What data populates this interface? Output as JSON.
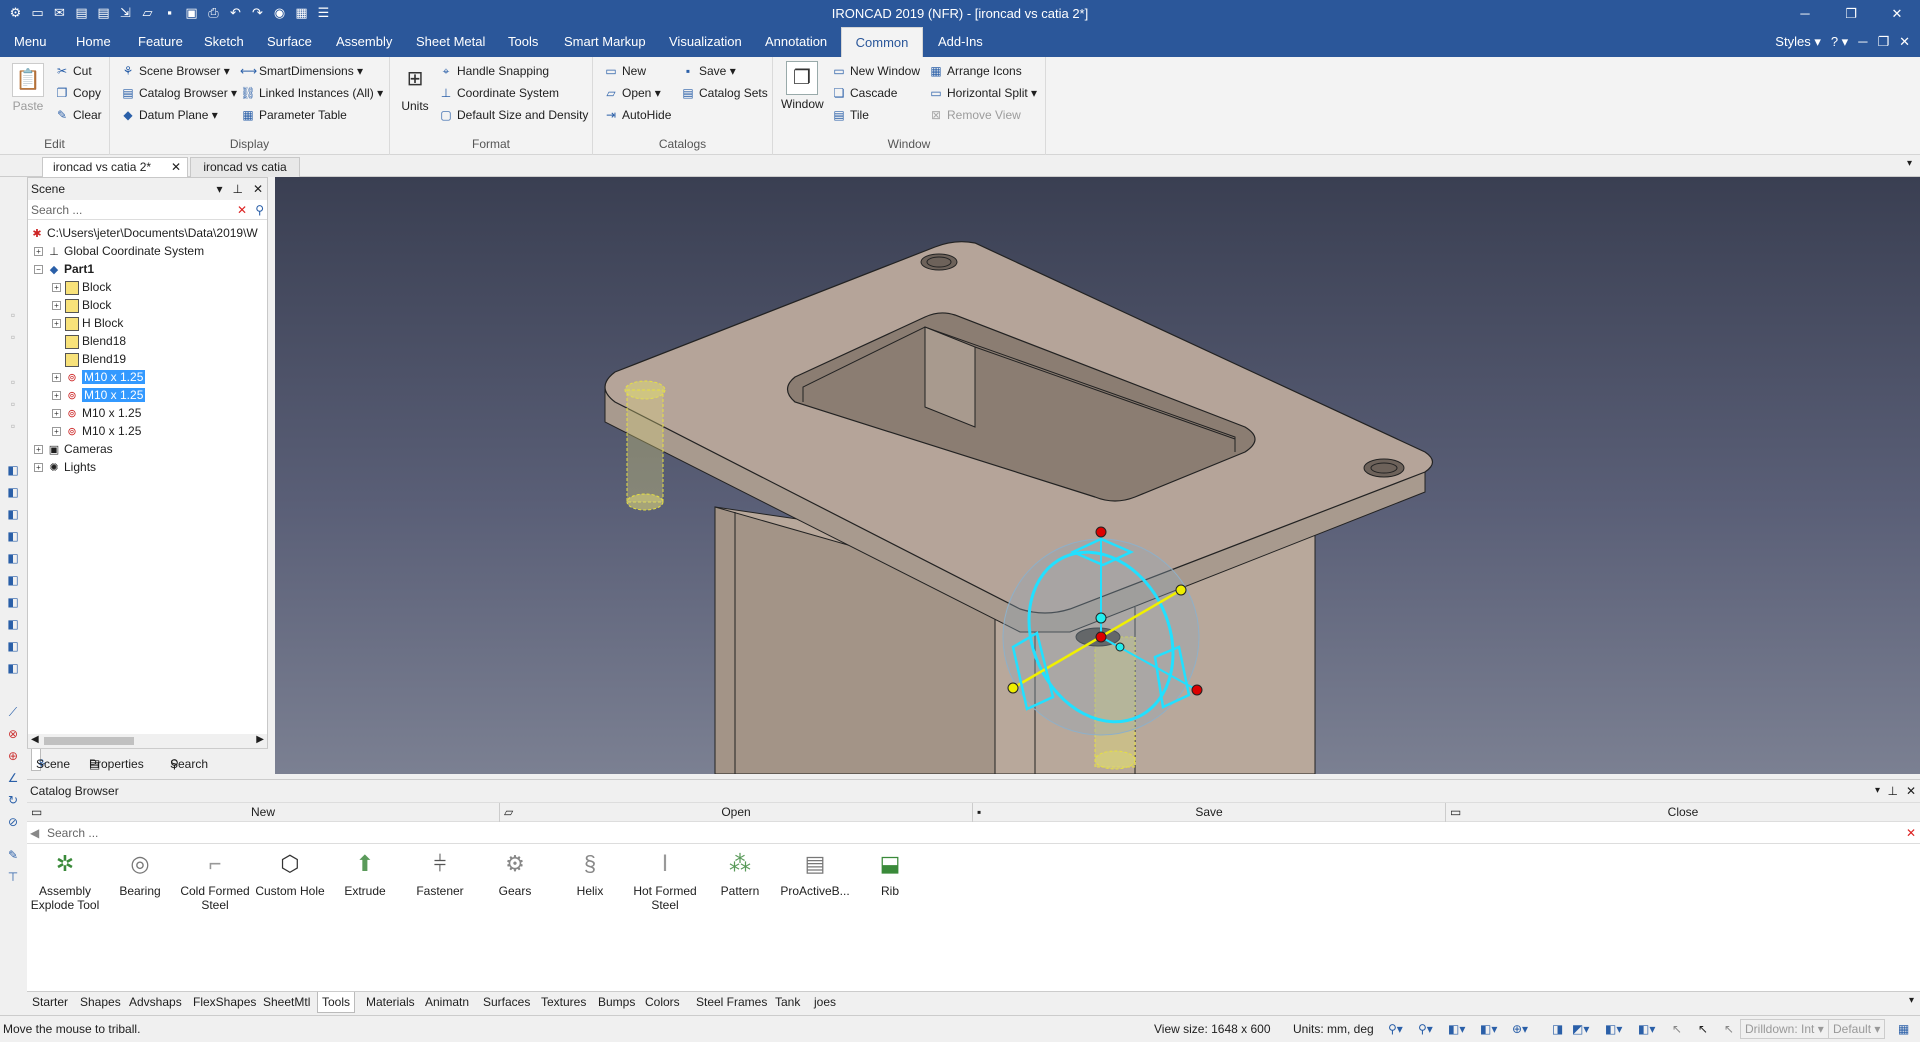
{
  "window": {
    "title": "IRONCAD 2019 (NFR) - [ironcad vs catia 2*]"
  },
  "quick_access": [
    "new-icon",
    "email-icon",
    "pdf-icon",
    "pdf2-icon",
    "export-icon",
    "open-icon",
    "save-icon",
    "save-as-icon",
    "print-icon",
    "undo-icon",
    "redo-icon",
    "globe-icon",
    "grid-icon",
    "menu-icon"
  ],
  "ribbon_tabs": [
    "Menu",
    "Home",
    "Feature",
    "Sketch",
    "Surface",
    "Assembly",
    "Sheet Metal",
    "Tools",
    "Smart Markup",
    "Visualization",
    "Annotation",
    "Common",
    "Add-Ins"
  ],
  "styles_label": "Styles",
  "edit": {
    "paste": "Paste",
    "cut": "Cut",
    "copy": "Copy",
    "clear": "Clear",
    "group": "Edit"
  },
  "display": {
    "scene_browser": "Scene Browser",
    "catalog_browser": "Catalog Browser",
    "datum_plane": "Datum Plane",
    "smart_dimensions": "SmartDimensions",
    "linked_instances": "Linked Instances (All)",
    "parameter_table": "Parameter Table",
    "group": "Display"
  },
  "format": {
    "units": "Units",
    "handle_snapping": "Handle Snapping",
    "coordinate_system": "Coordinate System",
    "default_size": "Default Size and Density",
    "group": "Format"
  },
  "catalogs": {
    "new": "New",
    "open": "Open",
    "autohide": "AutoHide",
    "save": "Save",
    "catalog_sets": "Catalog Sets",
    "group": "Catalogs"
  },
  "window_grp": {
    "window": "Window",
    "new_window": "New Window",
    "cascade": "Cascade",
    "tile": "Tile",
    "arrange_icons": "Arrange Icons",
    "horizontal_split": "Horizontal Split",
    "remove_view": "Remove View",
    "group": "Window"
  },
  "doc_tabs": [
    "ironcad vs catia 2*",
    "ironcad vs catia"
  ],
  "scene": {
    "title": "Scene",
    "search_placeholder": "Search ...",
    "tree": [
      {
        "label": "C:\\Users\\jeter\\Documents\\Data\\2019\\W"
      },
      {
        "label": "Global Coordinate System"
      },
      {
        "label": "Part1"
      },
      {
        "label": "Block"
      },
      {
        "label": "Block"
      },
      {
        "label": "H Block"
      },
      {
        "label": "Blend18"
      },
      {
        "label": "Blend19"
      },
      {
        "label": "M10 x 1.25"
      },
      {
        "label": "M10 x 1.25"
      },
      {
        "label": "M10 x 1.25"
      },
      {
        "label": "M10 x 1.25"
      },
      {
        "label": "Cameras"
      },
      {
        "label": "Lights"
      }
    ],
    "tabs": [
      "Scene",
      "Properties",
      "Search"
    ]
  },
  "catalog": {
    "title": "Catalog Browser",
    "buttons": [
      "New",
      "Open",
      "Save",
      "Close"
    ],
    "search_placeholder": "Search ...",
    "items": [
      "Assembly Explode Tool",
      "Bearing",
      "Cold Formed Steel",
      "Custom Hole",
      "Extrude",
      "Fastener",
      "Gears",
      "Helix",
      "Hot Formed Steel",
      "Pattern",
      "ProActiveB...",
      "Rib"
    ],
    "tabs": [
      "Starter",
      "Shapes",
      "Advshaps",
      "FlexShapes",
      "SheetMtl",
      "Tools",
      "Materials",
      "Animatn",
      "Surfaces",
      "Textures",
      "Bumps",
      "Colors",
      "Steel Frames",
      "Tank",
      "joes"
    ],
    "active_tab": "Tools"
  },
  "status": {
    "message": "Move the mouse to triball.",
    "view_size": "View size: 1648 x  600",
    "units": "Units: mm, deg",
    "drilldown": "Drilldown: Int",
    "default": "Default"
  }
}
